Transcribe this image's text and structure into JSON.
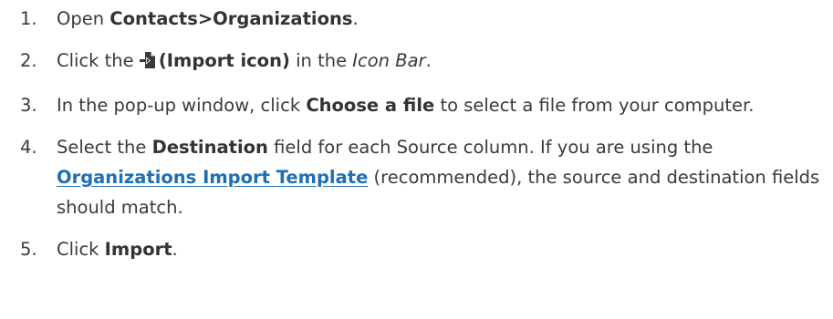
{
  "steps": [
    {
      "number": "1.",
      "parts": {
        "pre": "Open ",
        "bold": "Contacts>Organizations",
        "post": "."
      }
    },
    {
      "number": "2.",
      "parts": {
        "pre": "Click the ",
        "icon": "import-icon",
        "bold": "(Import icon)",
        "mid": " in the ",
        "italic": "Icon Bar",
        "post": "."
      }
    },
    {
      "number": "3.",
      "parts": {
        "pre": "In the pop-up window, click ",
        "bold": "Choose a file",
        "post": " to select a file from your computer."
      }
    },
    {
      "number": "4.",
      "parts": {
        "pre": "Select the ",
        "bold": "Destination",
        "mid": " field for each Source column. If you are using the ",
        "link": "Organizations Import Template",
        "post": " (recommended), the source and destination fields should match."
      }
    },
    {
      "number": "5.",
      "parts": {
        "pre": "Click ",
        "bold": "Import",
        "post": "."
      }
    }
  ],
  "colors": {
    "text": "#3a3a3a",
    "link": "#1f6fb3"
  }
}
